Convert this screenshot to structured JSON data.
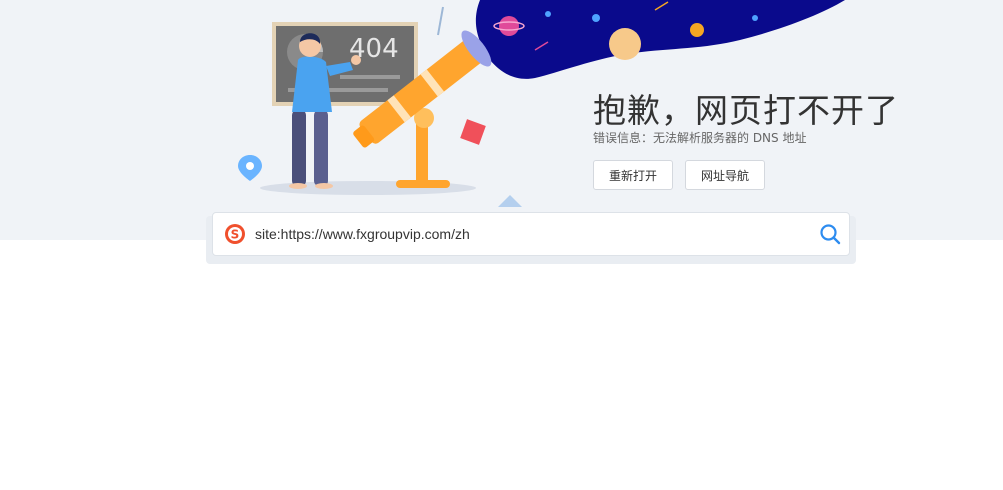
{
  "illustration": {
    "board_text": "404"
  },
  "error": {
    "title": "抱歉，网页打不开了",
    "info": "错误信息：无法解析服务器的 DNS 地址"
  },
  "buttons": {
    "reopen_label": "重新打开",
    "nav_label": "网址导航"
  },
  "search": {
    "value": "site:https://www.fxgroupvip.com/zh",
    "logo_icon": "sogou-logo-icon",
    "search_icon": "search-icon"
  },
  "colors": {
    "hero_bg": "#f0f3f7",
    "space_blue": "#0a0a8c",
    "telescope_orange": "#ffa52e",
    "accent_search": "#2d8cf0",
    "logo_red": "#f0502d"
  }
}
